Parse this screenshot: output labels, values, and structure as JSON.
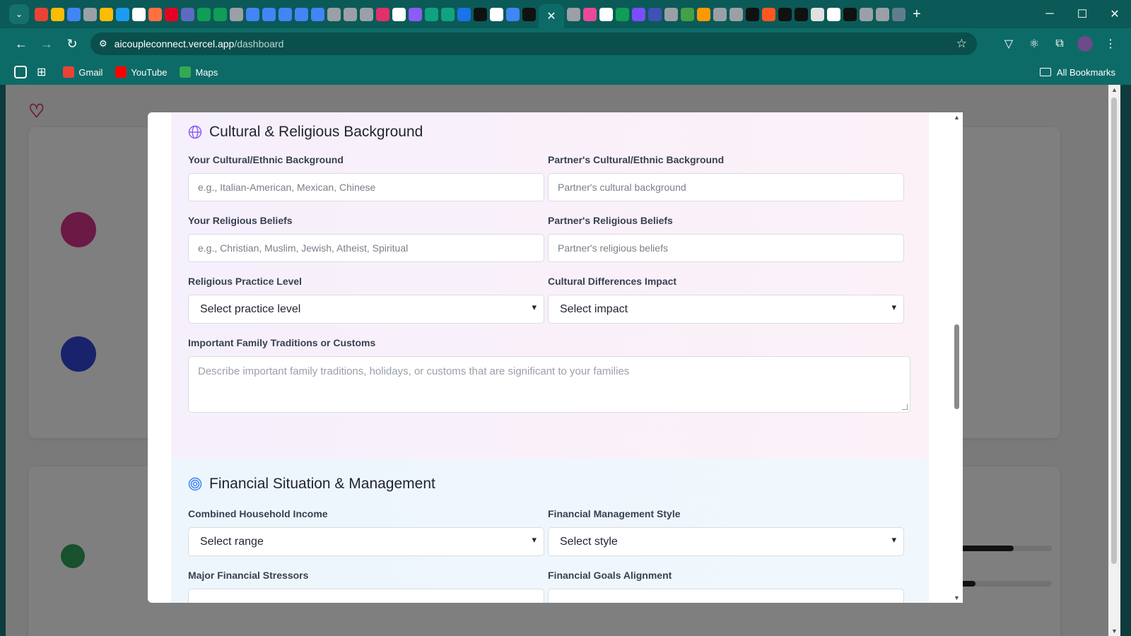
{
  "browser": {
    "url_host": "aicoupleconnect.vercel.app",
    "url_path": "/dashboard",
    "bookmarks": [
      {
        "label": "Gmail",
        "color": "#ea4335"
      },
      {
        "label": "YouTube",
        "color": "#ff0000"
      },
      {
        "label": "Maps",
        "color": "#34a853"
      }
    ],
    "all_bookmarks": "All Bookmarks"
  },
  "modal": {
    "cultural": {
      "title": "Cultural & Religious Background",
      "icon": "globe-icon",
      "accent": "#8b5cf6",
      "your_background_label": "Your Cultural/Ethnic Background",
      "your_background_placeholder": "e.g., Italian-American, Mexican, Chinese",
      "partner_background_label": "Partner's Cultural/Ethnic Background",
      "partner_background_placeholder": "Partner's cultural background",
      "your_religion_label": "Your Religious Beliefs",
      "your_religion_placeholder": "e.g., Christian, Muslim, Jewish, Atheist, Spiritual",
      "partner_religion_label": "Partner's Religious Beliefs",
      "partner_religion_placeholder": "Partner's religious beliefs",
      "practice_label": "Religious Practice Level",
      "practice_value": "Select practice level",
      "impact_label": "Cultural Differences Impact",
      "impact_value": "Select impact",
      "traditions_label": "Important Family Traditions or Customs",
      "traditions_placeholder": "Describe important family traditions, holidays, or customs that are significant to your families"
    },
    "financial": {
      "title": "Financial Situation & Management",
      "icon": "target-icon",
      "accent": "#3b82f6",
      "income_label": "Combined Household Income",
      "income_value": "Select range",
      "style_label": "Financial Management Style",
      "style_value": "Select style",
      "stressors_label": "Major Financial Stressors",
      "goals_label": "Financial Goals Alignment"
    }
  }
}
